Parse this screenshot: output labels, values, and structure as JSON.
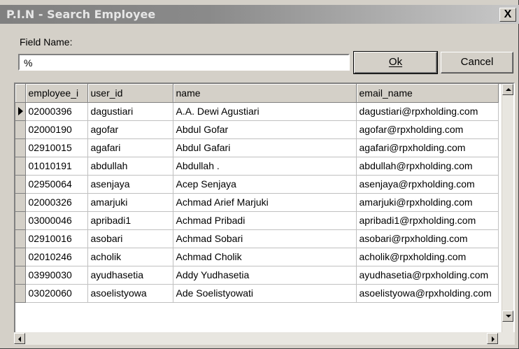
{
  "window": {
    "title": "P.I.N - Search Employee",
    "close_label": "X"
  },
  "search": {
    "field_label": "Field Name:",
    "value": "%"
  },
  "buttons": {
    "ok_label": "Ok",
    "cancel_label": "Cancel"
  },
  "table": {
    "columns": [
      "employee_i",
      "user_id",
      "name",
      "email_name"
    ],
    "selected_row": 0,
    "rows": [
      [
        "02000396",
        "dagustiari",
        "A.A. Dewi Agustiari",
        "dagustiari@rpxholding.com"
      ],
      [
        "02000190",
        "agofar",
        "Abdul Gofar",
        "agofar@rpxholding.com"
      ],
      [
        "02910015",
        "agafari",
        "Abdul Gafari",
        "agafari@rpxholding.com"
      ],
      [
        "01010191",
        "abdullah",
        "Abdullah .",
        "abdullah@rpxholding.com"
      ],
      [
        "02950064",
        "asenjaya",
        "Acep Senjaya",
        "asenjaya@rpxholding.com"
      ],
      [
        "02000326",
        "amarjuki",
        "Achmad Arief Marjuki",
        "amarjuki@rpxholding.com"
      ],
      [
        "03000046",
        "apribadi1",
        "Achmad Pribadi",
        "apribadi1@rpxholding.com"
      ],
      [
        "02910016",
        "asobari",
        "Achmad Sobari",
        "asobari@rpxholding.com"
      ],
      [
        "02010246",
        "acholik",
        "Achmad Cholik",
        "acholik@rpxholding.com"
      ],
      [
        "03990030",
        "ayudhasetia",
        "Addy Yudhasetia",
        "ayudhasetia@rpxholding.com"
      ],
      [
        "03020060",
        "asoelistyowa",
        "Ade Soelistyowati",
        "asoelistyowa@rpxholding.com"
      ]
    ]
  },
  "colors": {
    "titlebar": "#808080",
    "face": "#d4d0c8",
    "window_bg": "#ffffff"
  }
}
